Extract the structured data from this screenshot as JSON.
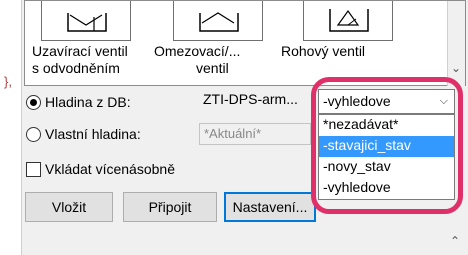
{
  "left_marker": "},",
  "symbols": [
    {
      "icon": "valve-icon",
      "caption_lines": [
        "Uzavírací ventil",
        "s odvodněním"
      ]
    },
    {
      "icon": "limiter-icon",
      "caption_lines": [
        "Omezovací/...",
        "ventil"
      ]
    },
    {
      "icon": "corner-valve-icon",
      "caption_lines": [
        "Rohový ventil",
        ""
      ]
    }
  ],
  "layer": {
    "db_radio_label": "Hladina z DB:",
    "db_value": "ZTI-DPS-arm...",
    "own_radio_label": "Vlastní hladina:",
    "own_input_placeholder": "*Aktuální*",
    "multiple_checkbox_label": "Vkládat vícenásobně"
  },
  "dropdown": {
    "selected": "-vyhledove",
    "options": [
      "*nezadávat*",
      "-stavajici_stav",
      "-novy_stav",
      "-vyhledove"
    ],
    "highlighted_index": 1
  },
  "buttons": {
    "insert": "Vložit",
    "attach": "Připojit",
    "settings": "Nastavení..."
  },
  "colors": {
    "highlight": "#e0306a",
    "selection": "#3399ff"
  }
}
